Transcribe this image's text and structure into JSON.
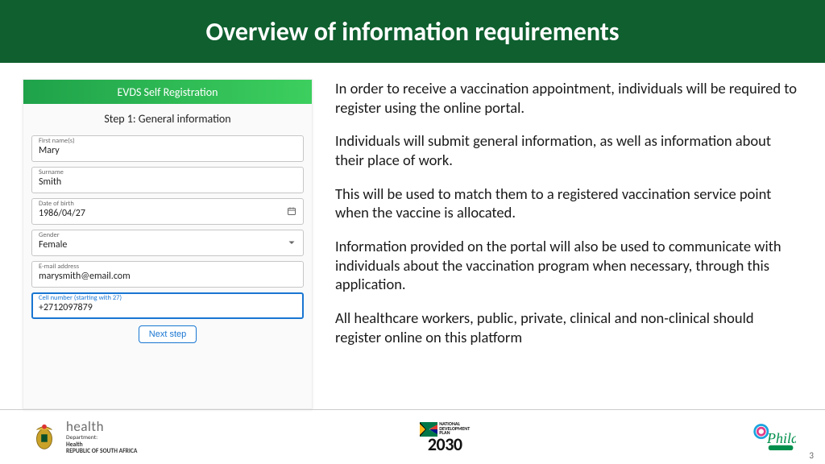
{
  "title": "Overview of information requirements",
  "form": {
    "header": "EVDS Self Registration",
    "step": "Step 1: General information",
    "fields": {
      "first_name": {
        "label": "First name(s)",
        "value": "Mary"
      },
      "surname": {
        "label": "Surname",
        "value": "Smith"
      },
      "dob": {
        "label": "Date of birth",
        "value": "1986/04/27"
      },
      "gender": {
        "label": "Gender",
        "value": "Female"
      },
      "email": {
        "label": "E-mail address",
        "value": "marysmith@email.com"
      },
      "cell": {
        "label": "Cell number (starting with 27)",
        "value": "+2712097879"
      }
    },
    "next_label": "Next step"
  },
  "paragraphs": [
    "In order to receive a vaccination appointment, individuals will be required to register using the online portal.",
    "Individuals will submit general information, as well as information about their place of work.",
    "This will be used to match them to a registered vaccination service point when the vaccine is allocated.",
    "Information provided on the portal will also be used to communicate with individuals about the vaccination program when necessary, through this application.",
    "All  healthcare workers, public, private, clinical and non-clinical should register online on this platform"
  ],
  "footer": {
    "health": {
      "word": "health",
      "line1": "Department:",
      "line2": "Health",
      "line3": "REPUBLIC OF SOUTH AFRICA"
    },
    "ndp": {
      "l1": "NATIONAL",
      "l2": "DEVELOPMENT",
      "l3": "PLAN",
      "year": "2030"
    },
    "phila": "Phila"
  },
  "page_number": "3"
}
